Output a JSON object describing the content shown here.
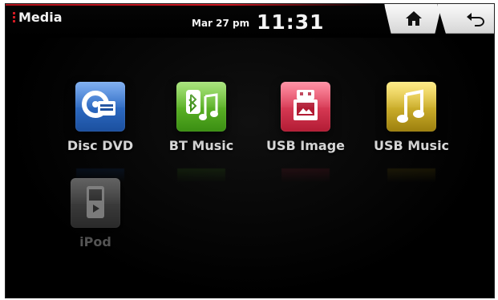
{
  "header": {
    "title": "Media",
    "date": "Mar 27 pm",
    "time": "11:31"
  },
  "nav": {
    "home_icon": "home-icon",
    "back_icon": "back-arrow-icon"
  },
  "colors": {
    "accent": "#d11a23",
    "disc_dvd": "#1f5fbf",
    "bt_music": "#4ea81f",
    "usb_image": "#c62a45",
    "usb_music": "#b59a12",
    "ipod": "#6b6b6b"
  },
  "sources": [
    {
      "id": "disc-dvd",
      "label": "Disc DVD",
      "icon": "disc-dvd-icon"
    },
    {
      "id": "bt-music",
      "label": "BT Music",
      "icon": "bluetooth-music-icon"
    },
    {
      "id": "usb-image",
      "label": "USB Image",
      "icon": "usb-image-icon"
    },
    {
      "id": "usb-music",
      "label": "USB Music",
      "icon": "usb-music-icon"
    },
    {
      "id": "ipod",
      "label": "iPod",
      "icon": "ipod-icon",
      "disabled": true
    }
  ]
}
